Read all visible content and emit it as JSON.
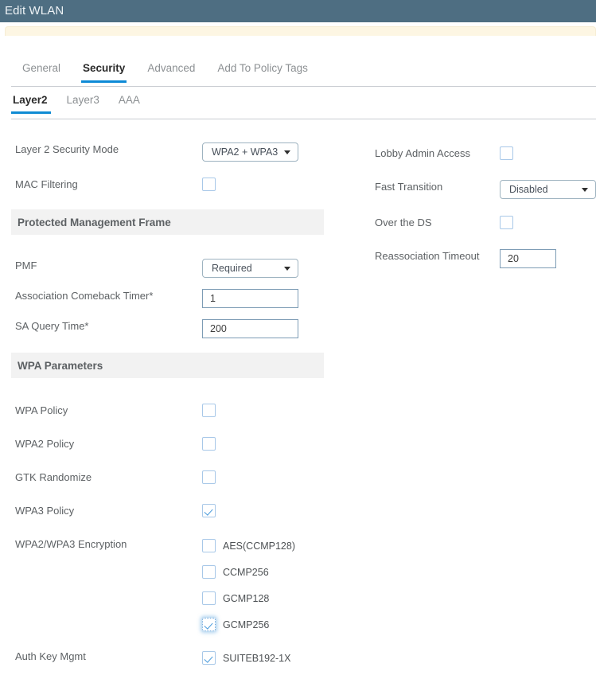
{
  "window": {
    "title": "Edit WLAN"
  },
  "tabs_primary": [
    {
      "label": "General",
      "active": false
    },
    {
      "label": "Security",
      "active": true
    },
    {
      "label": "Advanced",
      "active": false
    },
    {
      "label": "Add To Policy Tags",
      "active": false
    }
  ],
  "tabs_secondary": [
    {
      "label": "Layer2",
      "active": true
    },
    {
      "label": "Layer3",
      "active": false
    },
    {
      "label": "AAA",
      "active": false
    }
  ],
  "left_column": {
    "layer2_security_mode": {
      "label": "Layer 2 Security Mode",
      "value": "WPA2 + WPA3"
    },
    "mac_filtering": {
      "label": "MAC Filtering",
      "checked": false
    },
    "pmf_section": {
      "heading": "Protected Management Frame",
      "pmf": {
        "label": "PMF",
        "value": "Required"
      },
      "association_comeback_timer": {
        "label": "Association Comeback Timer*",
        "value": "1"
      },
      "sa_query_time": {
        "label": "SA Query Time*",
        "value": "200"
      }
    },
    "wpa_section": {
      "heading": "WPA Parameters",
      "policies": [
        {
          "label": "WPA Policy",
          "checked": false
        },
        {
          "label": "WPA2 Policy",
          "checked": false
        },
        {
          "label": "GTK Randomize",
          "checked": false
        },
        {
          "label": "WPA3 Policy",
          "checked": true
        }
      ],
      "encryption": {
        "label": "WPA2/WPA3 Encryption",
        "options": [
          {
            "label": "AES(CCMP128)",
            "checked": false,
            "focused": false
          },
          {
            "label": "CCMP256",
            "checked": false,
            "focused": false
          },
          {
            "label": "GCMP128",
            "checked": false,
            "focused": false
          },
          {
            "label": "GCMP256",
            "checked": true,
            "focused": true
          }
        ]
      },
      "auth_key_mgmt": {
        "label": "Auth Key Mgmt",
        "options": [
          {
            "label": "SUITEB192-1X",
            "checked": true,
            "focused": false
          }
        ]
      }
    }
  },
  "right_column": {
    "lobby_admin_access": {
      "label": "Lobby Admin Access",
      "checked": false
    },
    "fast_transition": {
      "label": "Fast Transition",
      "value": "Disabled"
    },
    "over_the_ds": {
      "label": "Over the DS",
      "checked": false
    },
    "reassociation_timeout": {
      "label": "Reassociation Timeout",
      "value": "20"
    }
  },
  "colors": {
    "titlebar": "#4e6e82",
    "accent": "#0d8ad6",
    "alert_strip": "#fdf6e3",
    "band": "#f2f2f2"
  }
}
